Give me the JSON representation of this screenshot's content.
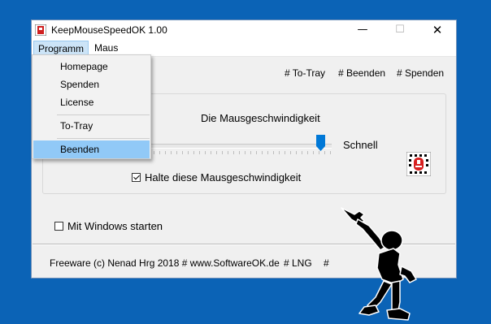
{
  "window": {
    "title": "KeepMouseSpeedOK 1.00",
    "controls": {
      "minimize": "—",
      "maximize": "☐",
      "close": "✕"
    }
  },
  "menubar": {
    "items": [
      "Programm",
      "Maus"
    ]
  },
  "dropdown": {
    "items": [
      "Homepage",
      "Spenden",
      "License",
      "To-Tray",
      "Beenden"
    ],
    "highlighted": "Beenden"
  },
  "toplinks": [
    "# To-Tray",
    "# Beenden",
    "# Spenden"
  ],
  "speed": {
    "heading": "Die Mausgeschwindigkeit",
    "fast_label": "Schnell",
    "slider_value_fraction": 0.96
  },
  "checkboxes": {
    "hold_speed": {
      "label": "Halte diese Mausgeschwindigkeit",
      "checked": true
    },
    "start_with_windows": {
      "label": "Mit Windows starten",
      "checked": false
    }
  },
  "footer": {
    "copyright": "Freeware (c) Nenad Hrg 2018 # www.SoftwareOK.de",
    "lng": "# LNG",
    "hash": "#"
  },
  "colors": {
    "background": "#0b63b6",
    "highlight": "#91c9f7",
    "slider_thumb": "#0078d7"
  },
  "icons": [
    "app-icon",
    "mouse-speed-icon",
    "stickman-pointing-icon"
  ]
}
